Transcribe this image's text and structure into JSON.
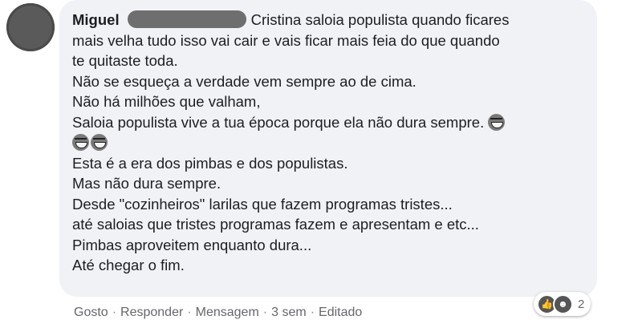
{
  "comment": {
    "author": "Miguel",
    "lines": [
      "Cristina saloia populista quando ficares",
      "mais velha tudo isso vai cair e vais ficar mais feia do que quando",
      "te quitaste toda.",
      "Não se esqueça a verdade vem sempre ao de cima.",
      "Não há milhões que valham,",
      "Saloia populista vive a tua época porque ela não dura sempre.",
      "",
      "Esta é a era dos pimbas e dos populistas.",
      "Mas não dura sempre.",
      "Desde \"cozinheiros\" larilas que fazem programas tristes...",
      "até saloias que tristes programas fazem e apresentam e etc...",
      "Pimbas aproveitem enquanto dura...",
      "Até chegar o fim."
    ],
    "emojis": [
      "laughing-emoji",
      "laughing-emoji",
      "laughing-emoji"
    ]
  },
  "actions": {
    "like": "Gosto",
    "reply": "Responder",
    "message": "Mensagem",
    "time": "3 sem",
    "edited": "Editado",
    "separator": "·"
  },
  "reactions": {
    "icons": [
      "like-icon",
      "haha-icon"
    ],
    "count": "2"
  }
}
